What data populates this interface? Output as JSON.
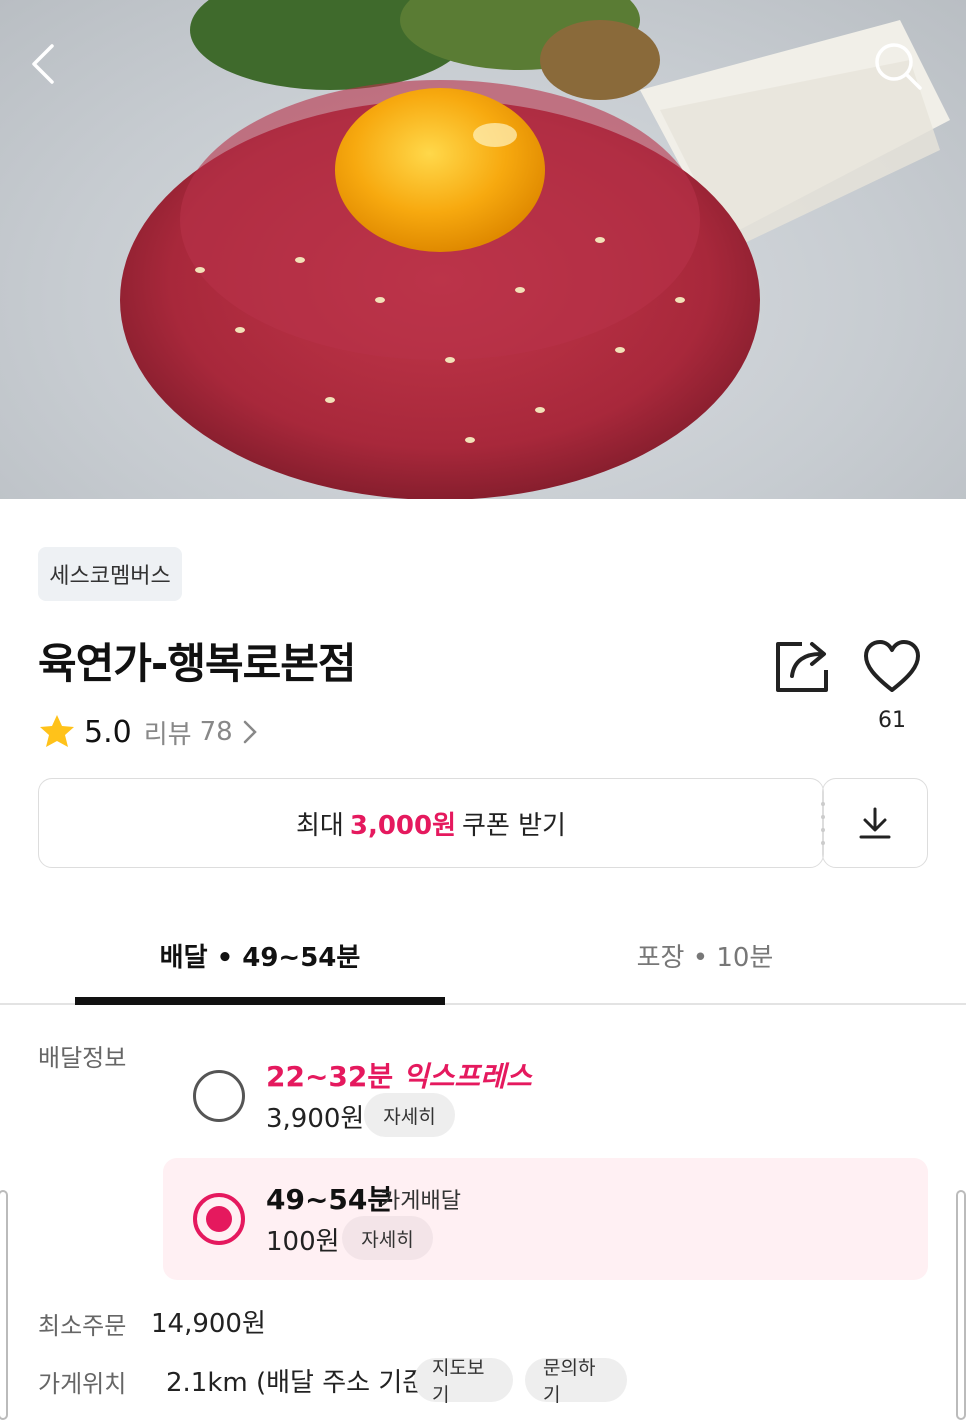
{
  "hero": {
    "image_alt": "육회 (beef tartare with egg yolk)"
  },
  "store": {
    "membership_badge": "세스코멤버스",
    "name": "육연가-행복로본점",
    "rating": "5.0",
    "review_label": "리뷰",
    "review_count": "78",
    "favorite_count": "61"
  },
  "coupon": {
    "prefix": "최대",
    "amount": "3,000원",
    "suffix": "쿠폰 받기"
  },
  "tabs": [
    {
      "label": "배달 • 49~54분",
      "active": true
    },
    {
      "label": "포장 • 10분",
      "active": false
    }
  ],
  "delivery_info": {
    "label": "배달정보",
    "options": [
      {
        "time": "22~32분",
        "tag": "익스프레스",
        "fee": "3,900원",
        "detail": "자세히",
        "selected": false
      },
      {
        "time": "49~54분",
        "tag": "가게배달",
        "fee": "100원",
        "detail": "자세히",
        "selected": true
      }
    ]
  },
  "min_order": {
    "label": "최소주문",
    "value": "14,900원"
  },
  "location": {
    "label": "가게위치",
    "value": "2.1km (배달 주소 기준)",
    "map_button": "지도보기",
    "inquiry_button": "문의하기"
  },
  "colors": {
    "accent": "#e5195e",
    "selected_bg": "#fff0f3"
  }
}
